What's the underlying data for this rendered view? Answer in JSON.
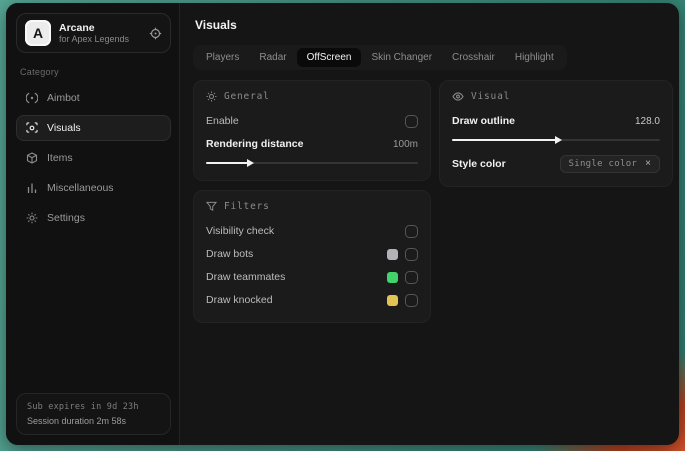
{
  "app": {
    "name": "Arcane",
    "subtitle": "for Apex Legends",
    "logo_letter": "A"
  },
  "sidebar": {
    "category_label": "Category",
    "items": [
      {
        "label": "Aimbot",
        "icon": "crosshair-icon"
      },
      {
        "label": "Visuals",
        "icon": "eye-scan-icon",
        "active": true
      },
      {
        "label": "Items",
        "icon": "cube-icon"
      },
      {
        "label": "Miscellaneous",
        "icon": "bars-icon"
      },
      {
        "label": "Settings",
        "icon": "gear-icon"
      }
    ],
    "footer": {
      "line1": "Sub expires in 9d 23h",
      "line2": "Session duration 2m 58s"
    }
  },
  "header": {
    "title": "Visuals"
  },
  "tabs": {
    "items": [
      "Players",
      "Radar",
      "OffScreen",
      "Skin Changer",
      "Crosshair",
      "Highlight"
    ],
    "active": "OffScreen"
  },
  "panels": {
    "general": {
      "title": "General",
      "enable_label": "Enable",
      "enable_checked": false,
      "distance_label": "Rendering distance",
      "distance_value": "100m",
      "distance_fill_pct": 20
    },
    "visual": {
      "title": "Visual",
      "outline_label": "Draw outline",
      "outline_value": "128.0",
      "outline_fill_pct": 50,
      "style_label": "Style color",
      "style_tag": "Single color",
      "style_tag_close": "×"
    },
    "filters": {
      "title": "Filters",
      "rows": [
        {
          "label": "Visibility check",
          "checked": false
        },
        {
          "label": "Draw bots",
          "swatch": "#b3b3b7",
          "checked": false
        },
        {
          "label": "Draw teammates",
          "swatch": "#41d46a",
          "checked": false
        },
        {
          "label": "Draw knocked",
          "swatch": "#e2c254",
          "checked": false
        }
      ]
    }
  },
  "colors": {
    "accent_green": "#41d46a",
    "accent_yellow": "#e2c254",
    "accent_gray": "#b3b3b7",
    "backdrop_teal": "#459080",
    "backdrop_orange": "#c2471f"
  }
}
